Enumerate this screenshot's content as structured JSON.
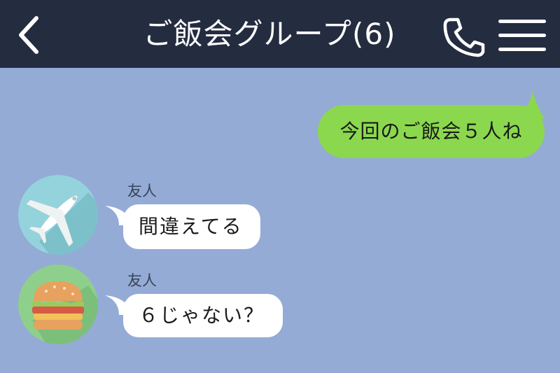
{
  "header": {
    "title": "ご飯会グループ(6)",
    "back_icon": "chevron-left-icon",
    "call_icon": "phone-icon",
    "menu_icon": "hamburger-menu-icon"
  },
  "messages": [
    {
      "direction": "outgoing",
      "text": "今回のご飯会５人ね"
    },
    {
      "direction": "incoming",
      "sender": "友人",
      "avatar_icon": "airplane-icon",
      "text": "間違えてる"
    },
    {
      "direction": "incoming",
      "sender": "友人",
      "avatar_icon": "hamburger-icon",
      "text": "６じゃない？"
    }
  ],
  "colors": {
    "header_bg": "#242c40",
    "chat_bg": "#94abd6",
    "outgoing_bubble": "#8bd84e",
    "incoming_bubble": "#ffffff"
  }
}
